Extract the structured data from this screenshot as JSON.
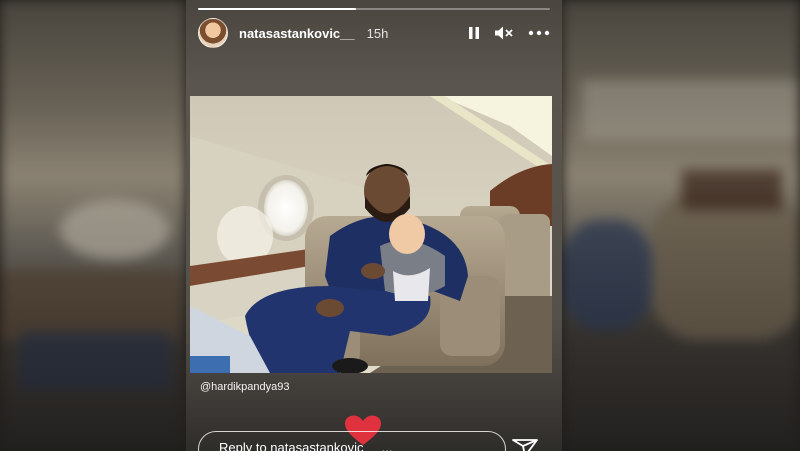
{
  "story": {
    "username": "natasastankovic__",
    "time": "15h",
    "progress": 0.45,
    "mention": "@hardikpandya93",
    "reply_placeholder": "Reply to natasastankovic__ ..."
  },
  "icons": {
    "pause": "pause-icon",
    "mute": "speaker-muted-icon",
    "more": "more-horizontal-icon",
    "heart": "heart-icon",
    "send": "send-paper-plane-icon"
  },
  "colors": {
    "heart": "#e0313f",
    "text": "#ffffff"
  }
}
